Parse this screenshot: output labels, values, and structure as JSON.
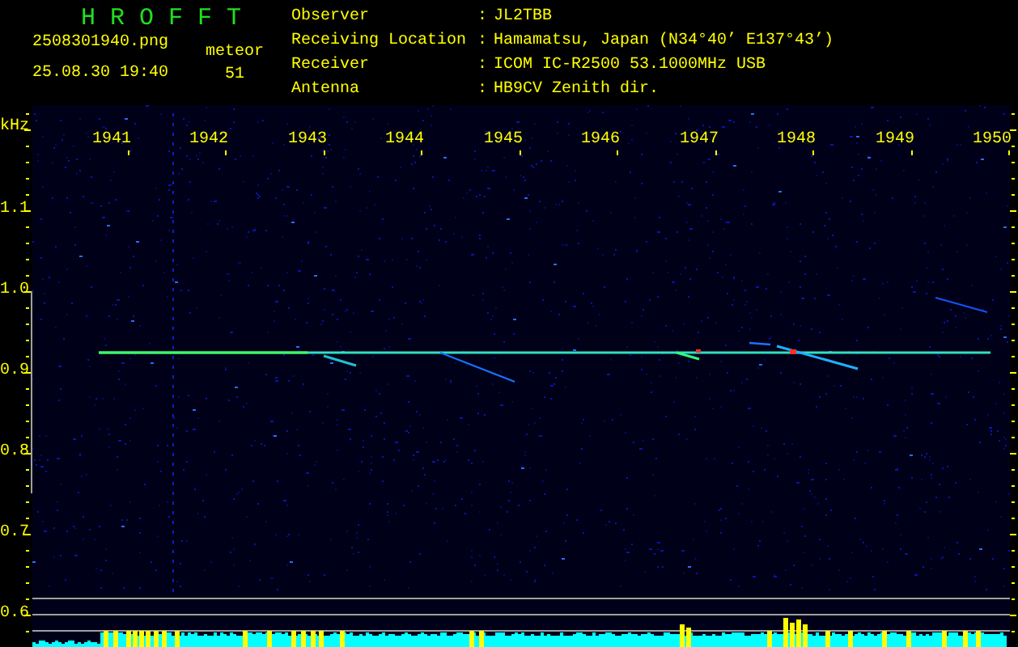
{
  "app": {
    "title": "H R O F F T"
  },
  "file": {
    "name": "2508301940.png",
    "datetime": "25.08.30 19:40"
  },
  "count": {
    "label": "meteor",
    "value": "51"
  },
  "station": [
    {
      "label": "Observer",
      "separator": ":",
      "value": "JL2TBB"
    },
    {
      "label": "Receiving Location",
      "separator": ":",
      "value": "Hamamatsu, Japan (N34°40’ E137°43’)"
    },
    {
      "label": "Receiver",
      "separator": ":",
      "value": "ICOM IC-R2500 53.1000MHz USB"
    },
    {
      "label": "Antenna",
      "separator": ":",
      "value": "HB9CV Zenith dir."
    }
  ],
  "plot": {
    "unit": "kHz",
    "time_labels": [
      "1941",
      "1942",
      "1943",
      "1944",
      "1945",
      "1946",
      "1947",
      "1948",
      "1949",
      "1950"
    ],
    "freq_labels": [
      "1.1",
      "1.0",
      "0.9",
      "0.8",
      "0.7",
      "0.6"
    ]
  }
}
